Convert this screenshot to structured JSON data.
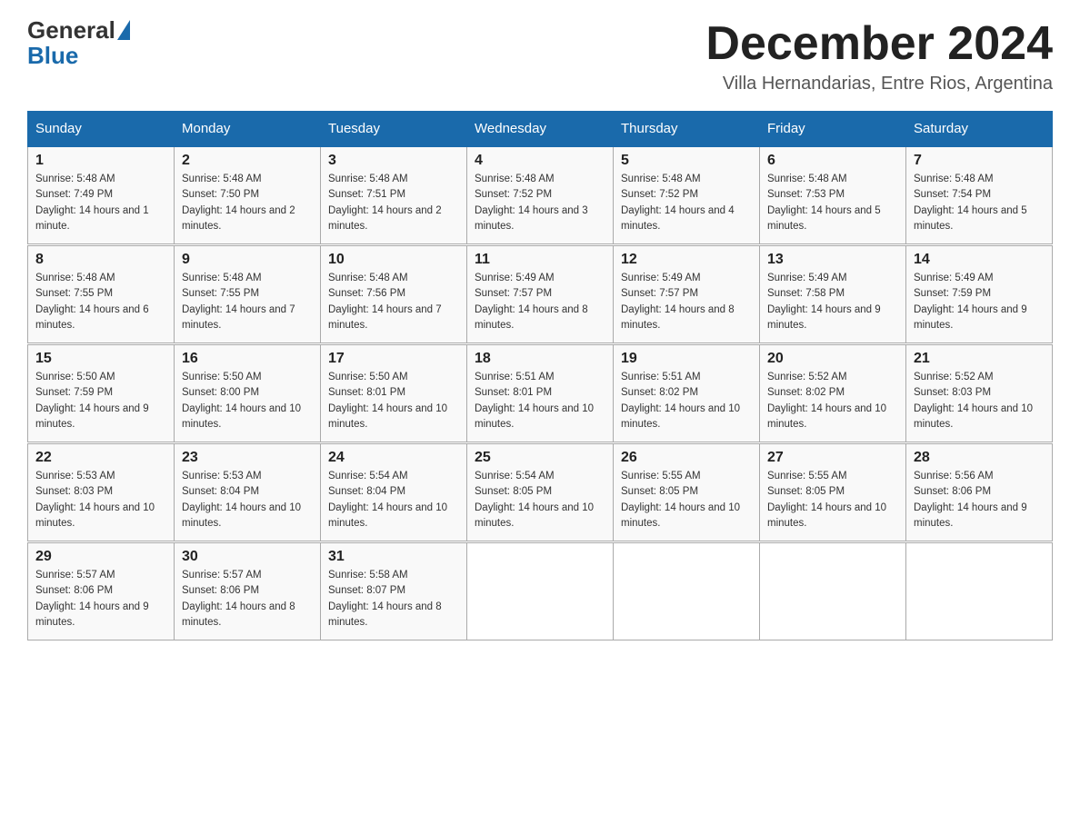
{
  "header": {
    "logo_general": "General",
    "logo_blue": "Blue",
    "month_title": "December 2024",
    "location": "Villa Hernandarias, Entre Rios, Argentina"
  },
  "weekdays": [
    "Sunday",
    "Monday",
    "Tuesday",
    "Wednesday",
    "Thursday",
    "Friday",
    "Saturday"
  ],
  "weeks": [
    [
      {
        "day": "1",
        "sunrise": "5:48 AM",
        "sunset": "7:49 PM",
        "daylight": "14 hours and 1 minute."
      },
      {
        "day": "2",
        "sunrise": "5:48 AM",
        "sunset": "7:50 PM",
        "daylight": "14 hours and 2 minutes."
      },
      {
        "day": "3",
        "sunrise": "5:48 AM",
        "sunset": "7:51 PM",
        "daylight": "14 hours and 2 minutes."
      },
      {
        "day": "4",
        "sunrise": "5:48 AM",
        "sunset": "7:52 PM",
        "daylight": "14 hours and 3 minutes."
      },
      {
        "day": "5",
        "sunrise": "5:48 AM",
        "sunset": "7:52 PM",
        "daylight": "14 hours and 4 minutes."
      },
      {
        "day": "6",
        "sunrise": "5:48 AM",
        "sunset": "7:53 PM",
        "daylight": "14 hours and 5 minutes."
      },
      {
        "day": "7",
        "sunrise": "5:48 AM",
        "sunset": "7:54 PM",
        "daylight": "14 hours and 5 minutes."
      }
    ],
    [
      {
        "day": "8",
        "sunrise": "5:48 AM",
        "sunset": "7:55 PM",
        "daylight": "14 hours and 6 minutes."
      },
      {
        "day": "9",
        "sunrise": "5:48 AM",
        "sunset": "7:55 PM",
        "daylight": "14 hours and 7 minutes."
      },
      {
        "day": "10",
        "sunrise": "5:48 AM",
        "sunset": "7:56 PM",
        "daylight": "14 hours and 7 minutes."
      },
      {
        "day": "11",
        "sunrise": "5:49 AM",
        "sunset": "7:57 PM",
        "daylight": "14 hours and 8 minutes."
      },
      {
        "day": "12",
        "sunrise": "5:49 AM",
        "sunset": "7:57 PM",
        "daylight": "14 hours and 8 minutes."
      },
      {
        "day": "13",
        "sunrise": "5:49 AM",
        "sunset": "7:58 PM",
        "daylight": "14 hours and 9 minutes."
      },
      {
        "day": "14",
        "sunrise": "5:49 AM",
        "sunset": "7:59 PM",
        "daylight": "14 hours and 9 minutes."
      }
    ],
    [
      {
        "day": "15",
        "sunrise": "5:50 AM",
        "sunset": "7:59 PM",
        "daylight": "14 hours and 9 minutes."
      },
      {
        "day": "16",
        "sunrise": "5:50 AM",
        "sunset": "8:00 PM",
        "daylight": "14 hours and 10 minutes."
      },
      {
        "day": "17",
        "sunrise": "5:50 AM",
        "sunset": "8:01 PM",
        "daylight": "14 hours and 10 minutes."
      },
      {
        "day": "18",
        "sunrise": "5:51 AM",
        "sunset": "8:01 PM",
        "daylight": "14 hours and 10 minutes."
      },
      {
        "day": "19",
        "sunrise": "5:51 AM",
        "sunset": "8:02 PM",
        "daylight": "14 hours and 10 minutes."
      },
      {
        "day": "20",
        "sunrise": "5:52 AM",
        "sunset": "8:02 PM",
        "daylight": "14 hours and 10 minutes."
      },
      {
        "day": "21",
        "sunrise": "5:52 AM",
        "sunset": "8:03 PM",
        "daylight": "14 hours and 10 minutes."
      }
    ],
    [
      {
        "day": "22",
        "sunrise": "5:53 AM",
        "sunset": "8:03 PM",
        "daylight": "14 hours and 10 minutes."
      },
      {
        "day": "23",
        "sunrise": "5:53 AM",
        "sunset": "8:04 PM",
        "daylight": "14 hours and 10 minutes."
      },
      {
        "day": "24",
        "sunrise": "5:54 AM",
        "sunset": "8:04 PM",
        "daylight": "14 hours and 10 minutes."
      },
      {
        "day": "25",
        "sunrise": "5:54 AM",
        "sunset": "8:05 PM",
        "daylight": "14 hours and 10 minutes."
      },
      {
        "day": "26",
        "sunrise": "5:55 AM",
        "sunset": "8:05 PM",
        "daylight": "14 hours and 10 minutes."
      },
      {
        "day": "27",
        "sunrise": "5:55 AM",
        "sunset": "8:05 PM",
        "daylight": "14 hours and 10 minutes."
      },
      {
        "day": "28",
        "sunrise": "5:56 AM",
        "sunset": "8:06 PM",
        "daylight": "14 hours and 9 minutes."
      }
    ],
    [
      {
        "day": "29",
        "sunrise": "5:57 AM",
        "sunset": "8:06 PM",
        "daylight": "14 hours and 9 minutes."
      },
      {
        "day": "30",
        "sunrise": "5:57 AM",
        "sunset": "8:06 PM",
        "daylight": "14 hours and 8 minutes."
      },
      {
        "day": "31",
        "sunrise": "5:58 AM",
        "sunset": "8:07 PM",
        "daylight": "14 hours and 8 minutes."
      },
      null,
      null,
      null,
      null
    ]
  ]
}
